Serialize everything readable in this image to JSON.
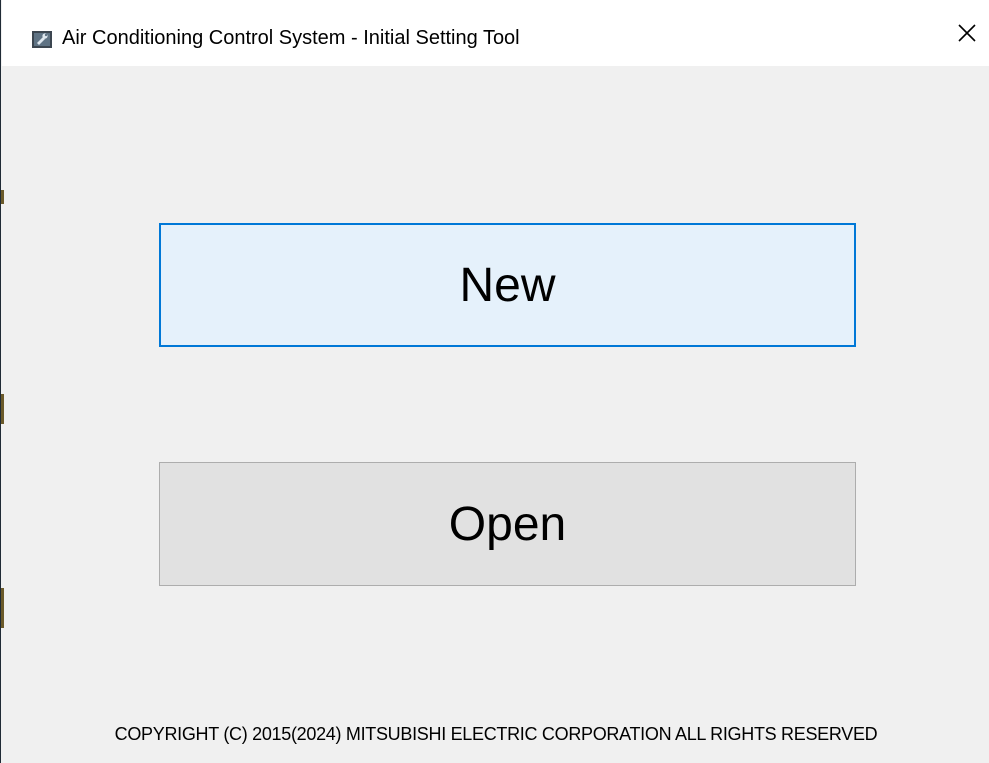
{
  "window": {
    "title": "Air Conditioning Control System - Initial Setting Tool",
    "app_icon": "app-wrench-icon",
    "close_icon": "close-icon"
  },
  "main": {
    "new_label": "New",
    "open_label": "Open"
  },
  "footer": {
    "copyright": "COPYRIGHT (C) 2015(2024) MITSUBISHI ELECTRIC CORPORATION ALL RIGHTS RESERVED"
  },
  "colors": {
    "background": "#f0f0f0",
    "titlebar": "#ffffff",
    "new_button_bg": "#e5f1fb",
    "new_button_border": "#0078d7",
    "open_button_bg": "#e1e1e1",
    "open_button_border": "#adadad"
  }
}
